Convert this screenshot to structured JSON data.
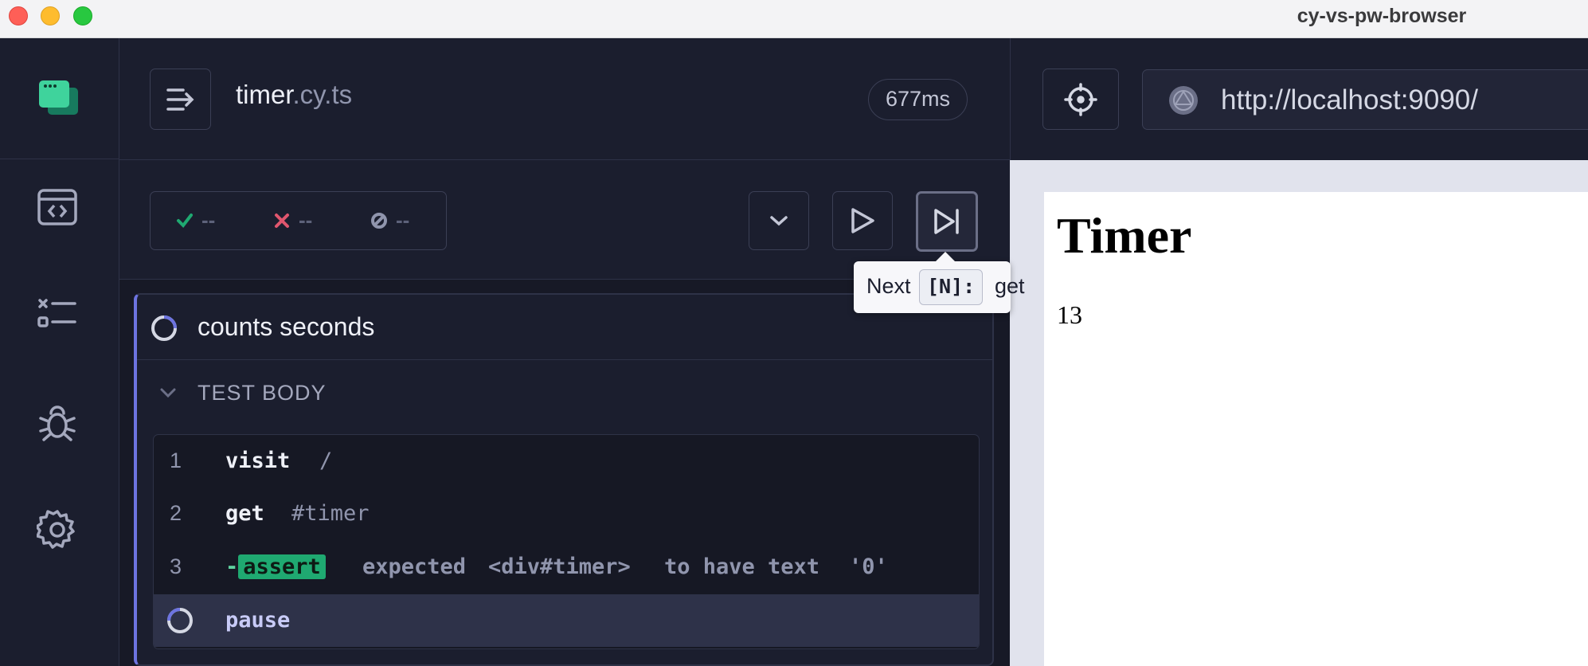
{
  "window": {
    "title": "cy-vs-pw-browser"
  },
  "spec": {
    "name": "timer",
    "ext": ".cy.ts",
    "duration": "677ms"
  },
  "stats": {
    "passed": "--",
    "failed": "--",
    "pending": "--"
  },
  "test": {
    "title": "counts seconds",
    "section": "TEST BODY",
    "commands": [
      {
        "num": "1",
        "name": "visit",
        "message": "/"
      },
      {
        "num": "2",
        "name": "get",
        "message": "#timer"
      },
      {
        "num": "3",
        "prefix": "-",
        "name": "assert",
        "message_parts": [
          "expected",
          "<div#timer>",
          "to have text",
          "'0'"
        ]
      },
      {
        "num": "",
        "name": "pause",
        "message": ""
      }
    ]
  },
  "tooltip": {
    "prefix": "Next",
    "kbd": "[N]:",
    "suffix": "get"
  },
  "aut": {
    "url": "http://localhost:9090/",
    "heading": "Timer",
    "timer_value": "13"
  },
  "colors": {
    "accent": "#6d74e0",
    "pass": "#1fa971",
    "fail": "#e0566e",
    "bg": "#1b1e2e"
  }
}
